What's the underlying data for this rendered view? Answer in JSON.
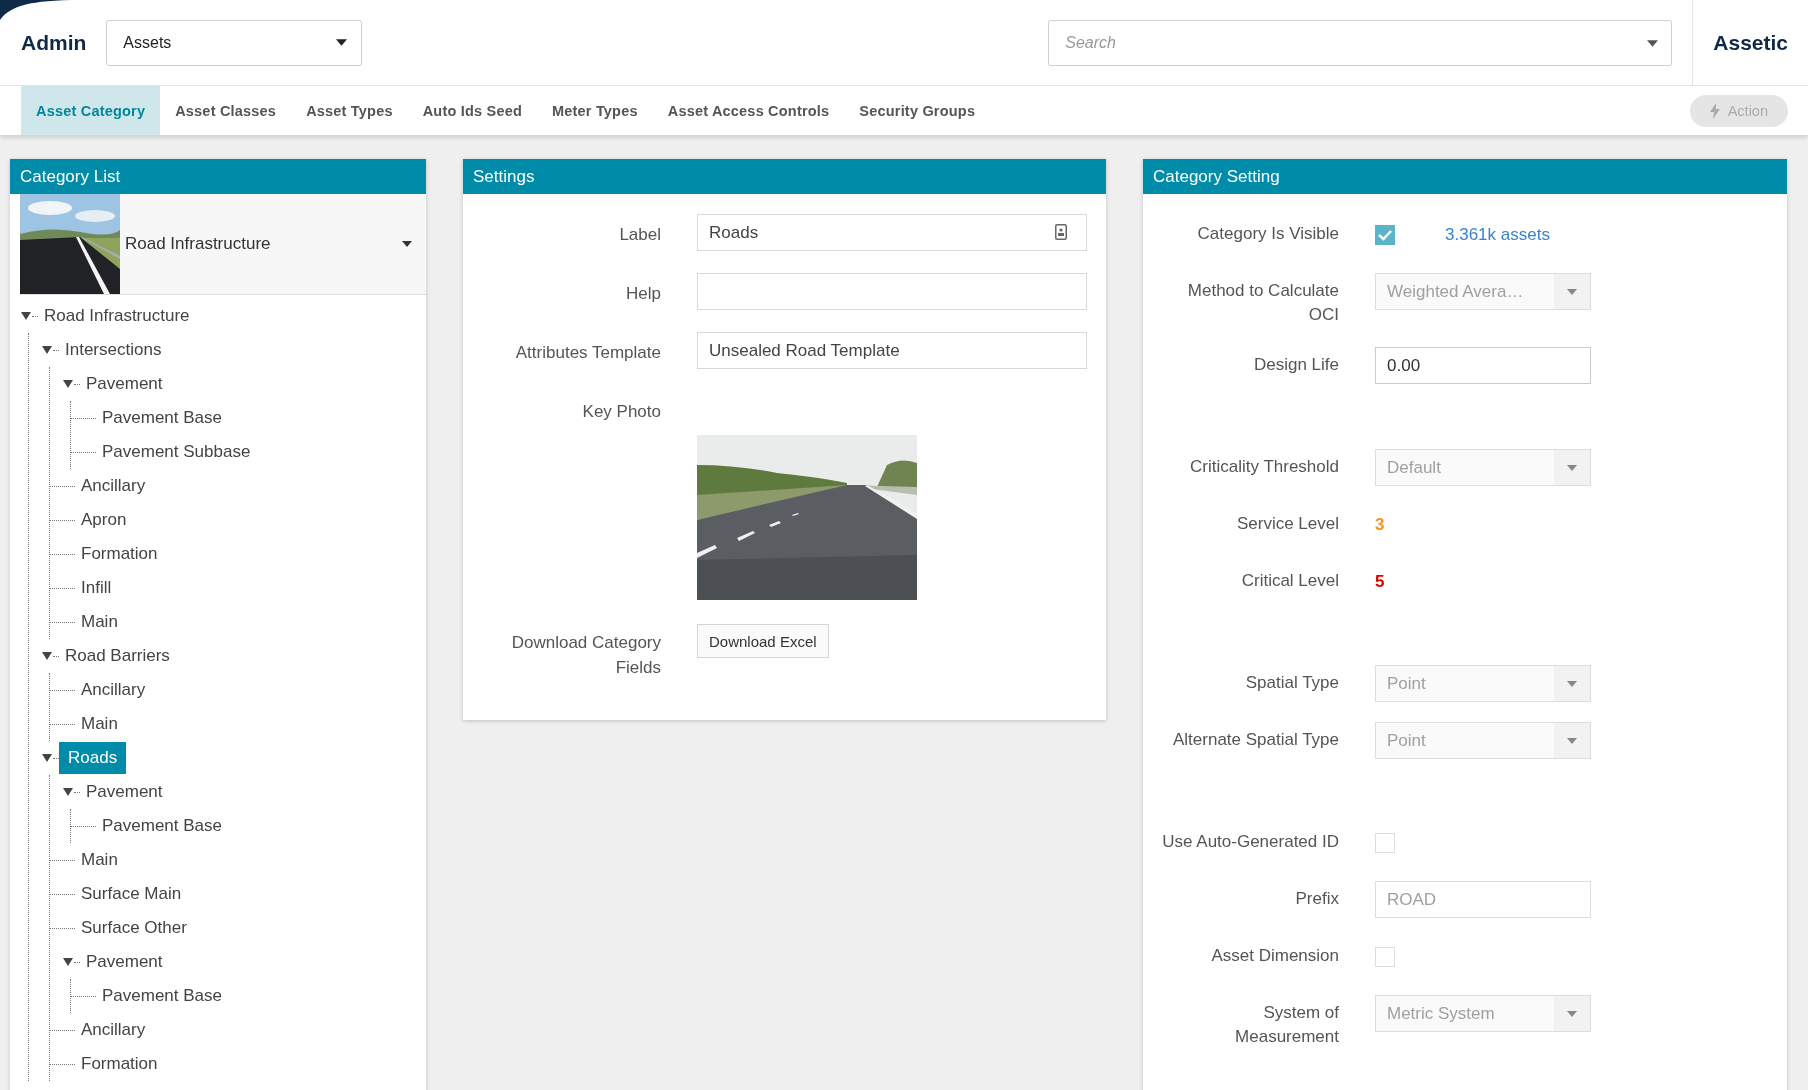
{
  "header": {
    "title": "Admin",
    "module_select": {
      "value": "Assets"
    },
    "search": {
      "placeholder": "Search"
    },
    "brand": "Assetic"
  },
  "tabs": [
    {
      "label": "Asset Category",
      "selected": true
    },
    {
      "label": "Asset Classes",
      "selected": false
    },
    {
      "label": "Asset Types",
      "selected": false
    },
    {
      "label": "Auto Ids Seed",
      "selected": false
    },
    {
      "label": "Meter Types",
      "selected": false
    },
    {
      "label": "Asset Access Controls",
      "selected": false
    },
    {
      "label": "Security Groups",
      "selected": false
    }
  ],
  "action_button": {
    "label": "Action",
    "disabled": true
  },
  "category_list": {
    "title": "Category List",
    "picker": {
      "kind": "picture",
      "value": "Road Infrastructure"
    },
    "tree": [
      {
        "label": "Road Infrastructure",
        "selected": false,
        "expanded": true,
        "children": [
          {
            "label": "Intersections",
            "selected": false,
            "expanded": true,
            "children": [
              {
                "label": "Pavement",
                "selected": false,
                "expanded": true,
                "children": [
                  {
                    "label": "Pavement Base",
                    "selected": false
                  },
                  {
                    "label": "Pavement Subbase",
                    "selected": false
                  }
                ]
              },
              {
                "label": "Ancillary",
                "selected": false
              },
              {
                "label": "Apron",
                "selected": false
              },
              {
                "label": "Formation",
                "selected": false
              },
              {
                "label": "Infill",
                "selected": false
              },
              {
                "label": "Main",
                "selected": false
              }
            ]
          },
          {
            "label": "Road Barriers",
            "selected": false,
            "expanded": true,
            "children": [
              {
                "label": "Ancillary",
                "selected": false
              },
              {
                "label": "Main",
                "selected": false
              }
            ]
          },
          {
            "label": "Roads",
            "selected": true,
            "expanded": true,
            "children": [
              {
                "label": "Pavement",
                "selected": false,
                "expanded": true,
                "children": [
                  {
                    "label": "Pavement Base",
                    "selected": false
                  }
                ]
              },
              {
                "label": "Main",
                "selected": false
              },
              {
                "label": "Surface Main",
                "selected": false
              },
              {
                "label": "Surface Other",
                "selected": false
              },
              {
                "label": "Pavement",
                "selected": false,
                "expanded": true,
                "children": [
                  {
                    "label": "Pavement Base",
                    "selected": false
                  }
                ]
              },
              {
                "label": "Ancillary",
                "selected": false
              },
              {
                "label": "Formation",
                "selected": false
              }
            ]
          }
        ]
      }
    ]
  },
  "settings": {
    "title": "Settings",
    "fields": [
      {
        "kind": "input_with_icon",
        "label": "Label",
        "value": "Roads"
      },
      {
        "kind": "input",
        "label": "Help"
      },
      {
        "kind": "input",
        "label": "Attributes Template",
        "value": "Unsealed Road Template"
      },
      {
        "label": "Key Photo"
      },
      {
        "kind": "button",
        "label": "Download Category Fields",
        "button": "Download Excel"
      }
    ]
  },
  "category_setting": {
    "title": "Category Setting",
    "sections": [
      [
        {
          "kind": "checkbox",
          "label": "Category Is Visible",
          "checked": true,
          "link": "3.361k assets"
        },
        {
          "kind": "select",
          "label": "Method to Calculate OCI",
          "value": "Weighted Avera…",
          "disabled": true
        },
        {
          "kind": "input",
          "label": "Design Life",
          "value": "0.00",
          "disabled": false
        }
      ],
      [
        {
          "kind": "select",
          "label": "Criticality Threshold",
          "value": "Default",
          "disabled": true
        },
        {
          "kind": "value",
          "label": "Service Level",
          "value": "3",
          "color": "#f7941d"
        },
        {
          "kind": "value",
          "label": "Critical Level",
          "value": "5",
          "color": "#e80000"
        }
      ],
      [
        {
          "kind": "select",
          "label": "Spatial Type",
          "value": "Point",
          "disabled": true
        },
        {
          "kind": "select",
          "label": "Alternate Spatial Type",
          "value": "Point",
          "disabled": true
        }
      ],
      [
        {
          "kind": "checkbox",
          "label": "Use Auto-Generated ID",
          "checked": false
        },
        {
          "kind": "input",
          "label": "Prefix",
          "value": "ROAD",
          "disabled": true
        },
        {
          "kind": "checkbox",
          "label": "Asset Dimension",
          "checked": false
        },
        {
          "kind": "select",
          "label": "System of Measurement",
          "value": "Metric System",
          "disabled": true
        }
      ]
    ]
  }
}
